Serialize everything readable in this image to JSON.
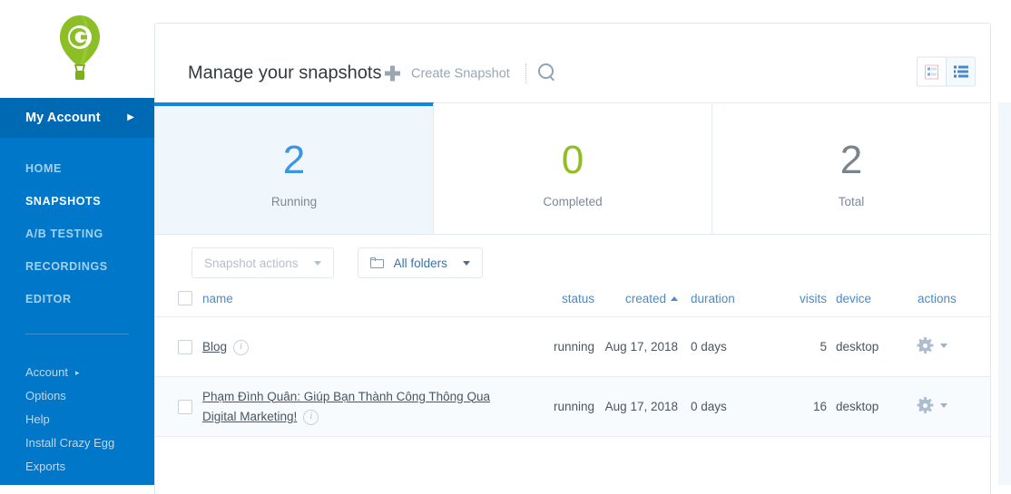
{
  "sidebar": {
    "logo_icon": "crazyegg-balloon-logo",
    "account": {
      "label": "My Account",
      "caret_icon": "chevron-right-icon"
    },
    "main_nav": [
      {
        "label": "HOME",
        "active": false
      },
      {
        "label": "SNAPSHOTS",
        "active": true
      },
      {
        "label": "A/B TESTING",
        "active": false
      },
      {
        "label": "RECORDINGS",
        "active": false
      },
      {
        "label": "EDITOR",
        "active": false
      }
    ],
    "sub_nav": [
      {
        "label": "Account",
        "caret": "▸"
      },
      {
        "label": "Options",
        "caret": ""
      },
      {
        "label": "Help",
        "caret": ""
      },
      {
        "label": "Install Crazy Egg",
        "caret": ""
      },
      {
        "label": "Exports",
        "caret": ""
      }
    ]
  },
  "header": {
    "title": "Manage your snapshots",
    "create_snapshot_label": "Create Snapshot",
    "plus_icon": "plus-icon",
    "search_icon": "search-icon",
    "view_toggle": [
      {
        "name": "card-view",
        "icon": "grid-cards-icon",
        "active": false
      },
      {
        "name": "list-view",
        "icon": "list-icon",
        "active": true
      }
    ]
  },
  "stats": [
    {
      "value": "2",
      "caption": "Running",
      "color": "#3d95e0",
      "active": true
    },
    {
      "value": "0",
      "caption": "Completed",
      "color": "#8fbe20",
      "active": false
    },
    {
      "value": "2",
      "caption": "Total",
      "color": "#7a848e",
      "active": false
    }
  ],
  "toolbar": {
    "snapshot_actions_label": "Snapshot actions",
    "all_folders_label": "All folders",
    "folder_icon": "folder-icon"
  },
  "table": {
    "columns": {
      "name": "name",
      "status": "status",
      "created": "created",
      "duration": "duration",
      "visits": "visits",
      "device": "device",
      "actions": "actions"
    },
    "sort": {
      "column": "created",
      "direction": "asc",
      "arrow": "sort-asc-icon"
    },
    "rows": [
      {
        "name": "Blog",
        "status": "running",
        "created": "Aug 17, 2018",
        "duration": "0 days",
        "visits": "5",
        "device": "desktop",
        "actions_icon": "gear-icon"
      },
      {
        "name": "Phạm Đình Quân: Giúp Bạn Thành Công Thông Qua Digital Marketing!",
        "status": "running",
        "created": "Aug 17, 2018",
        "duration": "0 days",
        "visits": "16",
        "device": "desktop",
        "actions_icon": "gear-icon"
      }
    ]
  },
  "colors": {
    "sidebar_blue": "#0077c8",
    "account_blue": "#0069b4",
    "accent_blue": "#0f87de",
    "link_blue": "#4a8bc9",
    "logo_green": "#8cbf26"
  }
}
